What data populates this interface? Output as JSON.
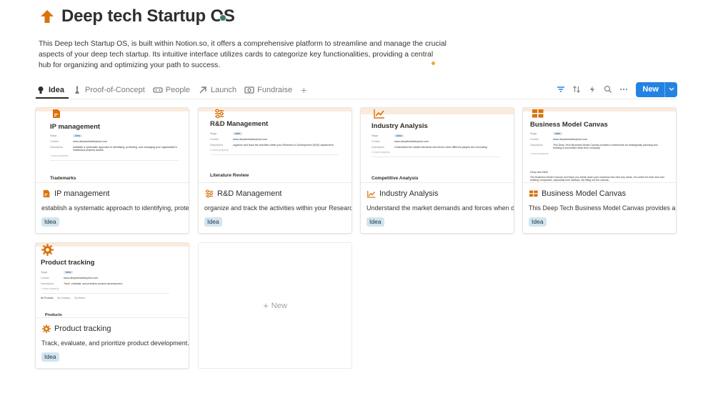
{
  "page": {
    "title": "Deep tech Startup OS",
    "icon": "arrow-up-icon",
    "description": "This Deep tech Startup OS, is built within Notion.so, it offers a comprehensive platform to streamline and manage the crucial aspects of your deep tech startup. Its intuitive interface utilizes cards to categorize key functionalities, providing a central hub for organizing and optimizing your path to success."
  },
  "tabs": [
    {
      "label": "Idea",
      "icon": "lightbulb-icon",
      "active": true
    },
    {
      "label": "Proof-of-Concept",
      "icon": "flask-icon"
    },
    {
      "label": "People",
      "icon": "vr-goggles-icon"
    },
    {
      "label": "Launch",
      "icon": "arrow-diagonal-icon"
    },
    {
      "label": "Fundraise",
      "icon": "money-icon"
    }
  ],
  "toolbar": {
    "new_label": "New",
    "icons": [
      "filter-icon",
      "sort-icon",
      "lightning-icon",
      "search-icon",
      "more-icon"
    ]
  },
  "colors": {
    "accent": "#2383e2",
    "card_icon": "#d9730d",
    "tag_bg": "#d3e5ef"
  },
  "cards": [
    {
      "title": "IP management",
      "icon": "document-icon",
      "description": "establish a systematic approach to identifying, protecting, and managing your organization's intellectual property assets.",
      "tag": "Idea",
      "preview": {
        "title": "IP management",
        "props": [
          {
            "key": "Stage",
            "value": "Idea"
          },
          {
            "key": "Creator",
            "value": "www.deeptechstartuphub.com"
          },
          {
            "key": "Description",
            "value": "establish a systematic approach to identifying, protecting, and managing your organization's intellectual property assets."
          }
        ],
        "more": "1 more property",
        "section": "Trademarks"
      }
    },
    {
      "title": "R&D Management",
      "icon": "sliders-icon",
      "description": "organize and track the activities within your Research & Development (R&D) department.",
      "tag": "Idea",
      "preview": {
        "title": "R&D Management",
        "props": [
          {
            "key": "Stage",
            "value": "Idea"
          },
          {
            "key": "Creator",
            "value": "www.deeptechstartuphub.com"
          },
          {
            "key": "Description",
            "value": "organize and track the activities within your Research & Development (R&D) department."
          }
        ],
        "more": "1 more property",
        "section": "Literature Review"
      }
    },
    {
      "title": "Industry Analysis",
      "icon": "trend-chart-icon",
      "description": "Understand the market demands and forces when different players are innovating",
      "tag": "Idea",
      "preview": {
        "title": "Industry Analysis",
        "props": [
          {
            "key": "Stage",
            "value": "Idea"
          },
          {
            "key": "Creator",
            "value": "www.deeptechstartuphub.com"
          },
          {
            "key": "Description",
            "value": "Understand the market demands and forces when different players are innovating"
          }
        ],
        "more": "1 more property",
        "section": "Competitive Analysis"
      }
    },
    {
      "title": "Business Model Canvas",
      "icon": "grid-canvas-icon",
      "description": "This Deep Tech Business Model Canvas provides a framework for strategically planning and building a successful deep tech company.",
      "tag": "Idea",
      "preview": {
        "title": "Business Model Canvas",
        "props": [
          {
            "key": "Stage",
            "value": "Idea"
          },
          {
            "key": "Creator",
            "value": "www.deeptechstartuphub.com"
          },
          {
            "key": "Description",
            "value": "This Deep Tech Business Model Canvas provides a framework for strategically planning and building a successful deep tech company."
          }
        ],
        "more": "1 more property",
        "section": "Deep tech BMC",
        "body": "The Business Model Canvas tool helps you break down your business into nine key areas. It's useful for both new and existing companies, especially tech startups. By filling out the canvas,"
      }
    },
    {
      "title": "Product tracking",
      "icon": "gear-icon",
      "description": "Track, evaluate, and prioritize product development.",
      "tag": "Idea",
      "preview": {
        "title": "Product tracking",
        "props": [
          {
            "key": "Stage",
            "value": "Idea"
          },
          {
            "key": "Creator",
            "value": "www.deeptechstartuphub.com"
          },
          {
            "key": "Description",
            "value": "Track, evaluate, and prioritize product development."
          }
        ],
        "more": "1 more property",
        "views": [
          "All Product",
          "By Industry",
          "By status"
        ],
        "section": "Products"
      }
    }
  ],
  "new_card_label": "New"
}
